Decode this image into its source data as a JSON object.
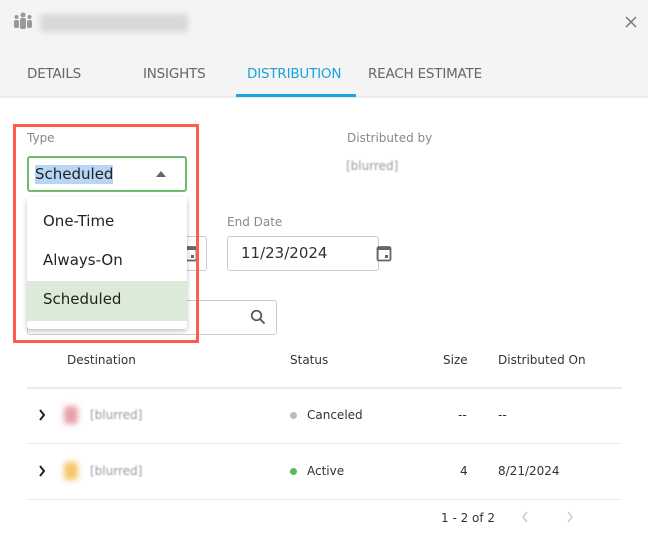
{
  "header": {
    "icon": "people-group-icon",
    "title": "[blurred]",
    "close_icon": "close-icon"
  },
  "tabs": [
    {
      "label": "DETAILS"
    },
    {
      "label": "INSIGHTS"
    },
    {
      "label": "DISTRIBUTION",
      "active": true
    },
    {
      "label": "REACH ESTIMATE"
    }
  ],
  "form": {
    "type_label": "Type",
    "type_value": "Scheduled",
    "type_options": [
      "One-Time",
      "Always-On",
      "Scheduled"
    ],
    "distributed_by_label": "Distributed by",
    "distributed_by_value": "[blurred]",
    "end_date_label": "End Date",
    "end_date_value": "11/23/2024"
  },
  "table": {
    "headers": [
      "Destination",
      "Status",
      "Size",
      "Distributed On"
    ],
    "rows": [
      {
        "destination": "[blurred]",
        "status": "Canceled",
        "status_color": "#bbbbbb",
        "size": "--",
        "distributed_on": "--"
      },
      {
        "destination": "[blurred]",
        "status": "Active",
        "status_color": "#5cb85c",
        "size": "4",
        "distributed_on": "8/21/2024"
      }
    ],
    "pagination": "1 - 2 of 2"
  },
  "colors": {
    "accent": "#1aa3dc",
    "highlight": "#ff5a4a",
    "focus": "#6dbb6d",
    "selected": "#dcebd8"
  }
}
